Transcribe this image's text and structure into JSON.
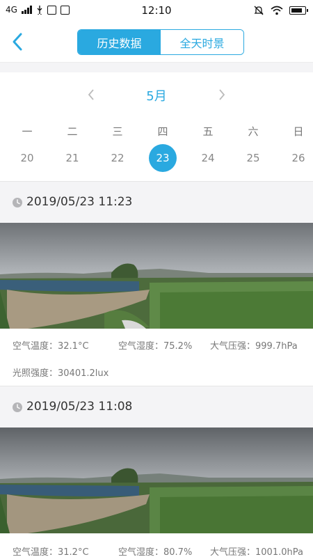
{
  "status_bar": {
    "network": "4G",
    "time": "12:10"
  },
  "nav": {
    "back_icon": "chevron-left-icon",
    "tabs": [
      {
        "label": "历史数据",
        "active": true
      },
      {
        "label": "全天时景",
        "active": false
      }
    ]
  },
  "calendar": {
    "month": "5月",
    "weekdays": [
      "一",
      "二",
      "三",
      "四",
      "五",
      "六",
      "日"
    ],
    "dates": [
      "20",
      "21",
      "22",
      "23",
      "24",
      "25",
      "26"
    ],
    "selected_date": "23"
  },
  "records": [
    {
      "timestamp": "2019/05/23 11:23",
      "air_temp": "空气温度：32.1°C",
      "air_humidity": "空气湿度：75.2%",
      "pressure": "大气压强：999.7hPa",
      "light": "光照强度：30401.2lux"
    },
    {
      "timestamp": "2019/05/23 11:08",
      "air_temp": "空气温度：31.2°C",
      "air_humidity": "空气湿度：80.7%",
      "pressure": "大气压强：1001.0hPa"
    }
  ],
  "colors": {
    "accent": "#2aa9e0",
    "background_gray": "#f4f4f6"
  }
}
